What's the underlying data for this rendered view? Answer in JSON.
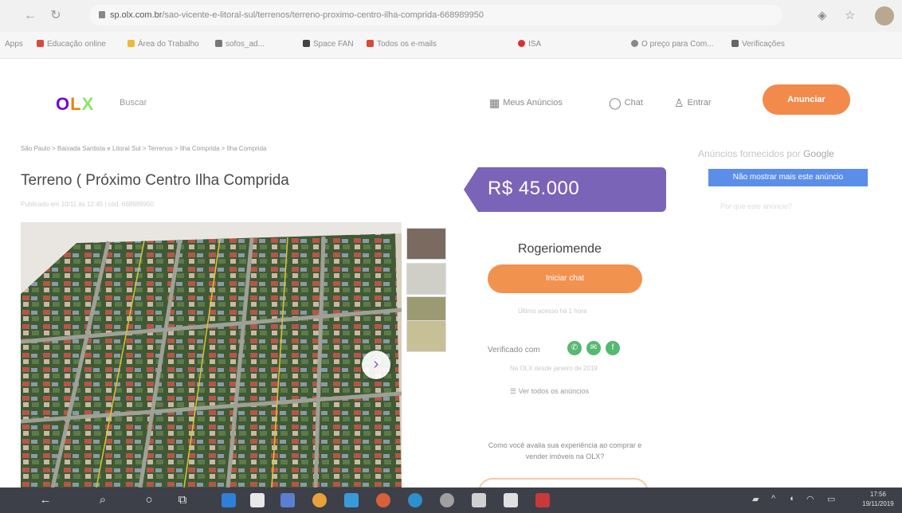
{
  "browser": {
    "url_host": "sp.olx.com.br",
    "url_path": "/sao-vicente-e-litoral-sul/terrenos/terreno-proximo-centro-ilha-comprida-668989950",
    "bookmarks": [
      "Apps",
      "Educação online",
      "Área do Trabalho",
      "sofos_ad...",
      "Space FAN",
      "Todos os e-mails",
      "ISA",
      "O preço para Com...",
      "Verificações"
    ]
  },
  "header": {
    "logo": {
      "o": "O",
      "l": "L",
      "x": "X"
    },
    "search_label": "Buscar",
    "my_ads_label": "Meus Anúncios",
    "chat_label": "Chat",
    "login_label": "Entrar",
    "post_button": "Anunciar"
  },
  "listing": {
    "breadcrumb": "São Paulo > Baixada Santista e Litoral Sul > Terrenos > Ilha Comprida > Ilha Comprida",
    "title": "Terreno ( Próximo Centro Ilha Comprida",
    "posted": "Publicado em 10/11 às 12:45 | cód. 668989950",
    "price": "R$ 45.000"
  },
  "seller": {
    "name": "Rogeriomende",
    "chat_button": "Iniciar chat",
    "faint_note": "Último acesso há 1 hora",
    "verified_label": "Verificado com",
    "verified_note": "Na OLX desde janeiro de 2019",
    "see_all": "Ver todos os anúncios",
    "question": "Como você avalia sua experiência ao comprar e vender imóveis na OLX?"
  },
  "ads": {
    "label": "Anúncios fornecidos por",
    "brand": "Google",
    "stop_button": "Não mostrar mais este anúncio",
    "why": "Por que este anúncio?"
  },
  "taskbar": {
    "time": "17:56",
    "date": "19/11/2019"
  },
  "colors": {
    "olx_purple": "#6e0ad6",
    "price_tag": "#7a64b8",
    "orange_button": "#f28a4b",
    "verified_green": "#56b871",
    "taskbar": "#3d3f49"
  }
}
